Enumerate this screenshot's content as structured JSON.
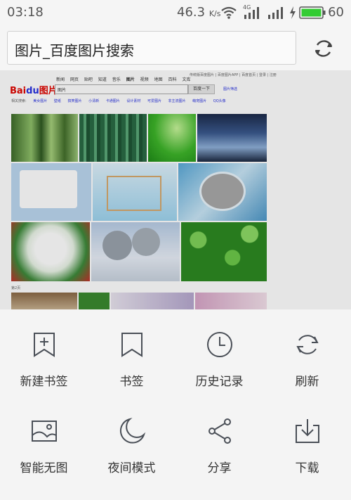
{
  "status_bar": {
    "time": "03:18",
    "speed_value": "46.3",
    "speed_unit": "K/s",
    "network_label": "4G",
    "battery_level": "60"
  },
  "address_bar": {
    "title": "图片_百度图片搜索"
  },
  "webpage": {
    "logo_text": "Bai",
    "logo_du": "du",
    "logo_tail": "图片",
    "nav": [
      "新闻",
      "网页",
      "贴吧",
      "知道",
      "音乐",
      "图片",
      "视频",
      "地图",
      "百科",
      "文库"
    ],
    "top_links": "传统版百度图片 | 百度图片APP | 百度首页 | 登录 | 注册",
    "search_value": "图片",
    "search_button": "百度一下",
    "advanced": "图片筛选",
    "related_label": "相关搜索:",
    "related": [
      "美女图片",
      "壁纸",
      "搞笑图片",
      "小清新",
      "卡通图片",
      "设计素材",
      "可爱图片",
      "非主流图片",
      "萌宠图片",
      "QQ头像"
    ],
    "page_label": "第2页"
  },
  "menu": [
    {
      "label": "新建书签",
      "icon": "add-bookmark-icon"
    },
    {
      "label": "书签",
      "icon": "bookmark-icon"
    },
    {
      "label": "历史记录",
      "icon": "history-clock-icon"
    },
    {
      "label": "刷新",
      "icon": "refresh-icon"
    },
    {
      "label": "智能无图",
      "icon": "no-image-icon"
    },
    {
      "label": "夜间模式",
      "icon": "moon-icon"
    },
    {
      "label": "分享",
      "icon": "share-icon"
    },
    {
      "label": "下载",
      "icon": "download-icon"
    }
  ]
}
